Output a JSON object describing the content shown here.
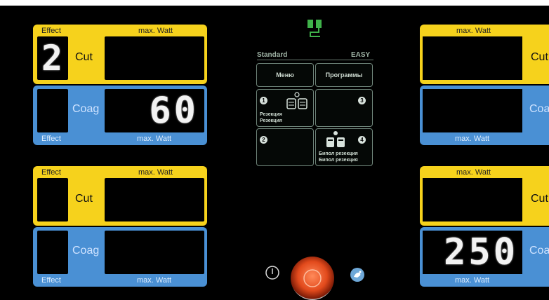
{
  "left_channels": [
    {
      "cut": {
        "effect_label": "Effect",
        "watt_label": "max. Watt",
        "name": "Cut",
        "effect_value": "2",
        "watt_value": ""
      },
      "coag": {
        "effect_label": "Effect",
        "watt_label": "max. Watt",
        "name": "Coag",
        "effect_value": "",
        "watt_value": "60"
      }
    },
    {
      "cut": {
        "effect_label": "Effect",
        "watt_label": "max. Watt",
        "name": "Cut",
        "effect_value": "",
        "watt_value": ""
      },
      "coag": {
        "effect_label": "Effect",
        "watt_label": "max. Watt",
        "name": "Coag",
        "effect_value": "",
        "watt_value": ""
      }
    }
  ],
  "right_channels": [
    {
      "cut": {
        "watt_label": "max. Watt",
        "name": "Cut",
        "watt_value": ""
      },
      "coag": {
        "watt_label": "max. Watt",
        "name": "Coa",
        "watt_value": ""
      }
    },
    {
      "cut": {
        "watt_label": "max. Watt",
        "name": "Cut",
        "watt_value": ""
      },
      "coag": {
        "watt_label": "max. Watt",
        "name": "Coa",
        "watt_value": "250"
      }
    }
  ],
  "center": {
    "mode_left": "Standard",
    "mode_right": "EASY",
    "menu_label": "Меню",
    "programs_label": "Программы",
    "slots": [
      {
        "number": "1",
        "lines": [
          "Резекция",
          "Резекция"
        ]
      },
      {
        "number": "3",
        "lines": []
      },
      {
        "number": "2",
        "lines": []
      },
      {
        "number": "4",
        "lines": [
          "Биnол резекция",
          "Биnол резекция"
        ]
      }
    ]
  },
  "colors": {
    "cut": "#f6d21c",
    "coag": "#4a90d4",
    "accent_green": "#3fb24a",
    "activate": "#e24a1c"
  },
  "icons": [
    "plug-icon",
    "power-icon",
    "activate-button",
    "footswitch-icon"
  ]
}
